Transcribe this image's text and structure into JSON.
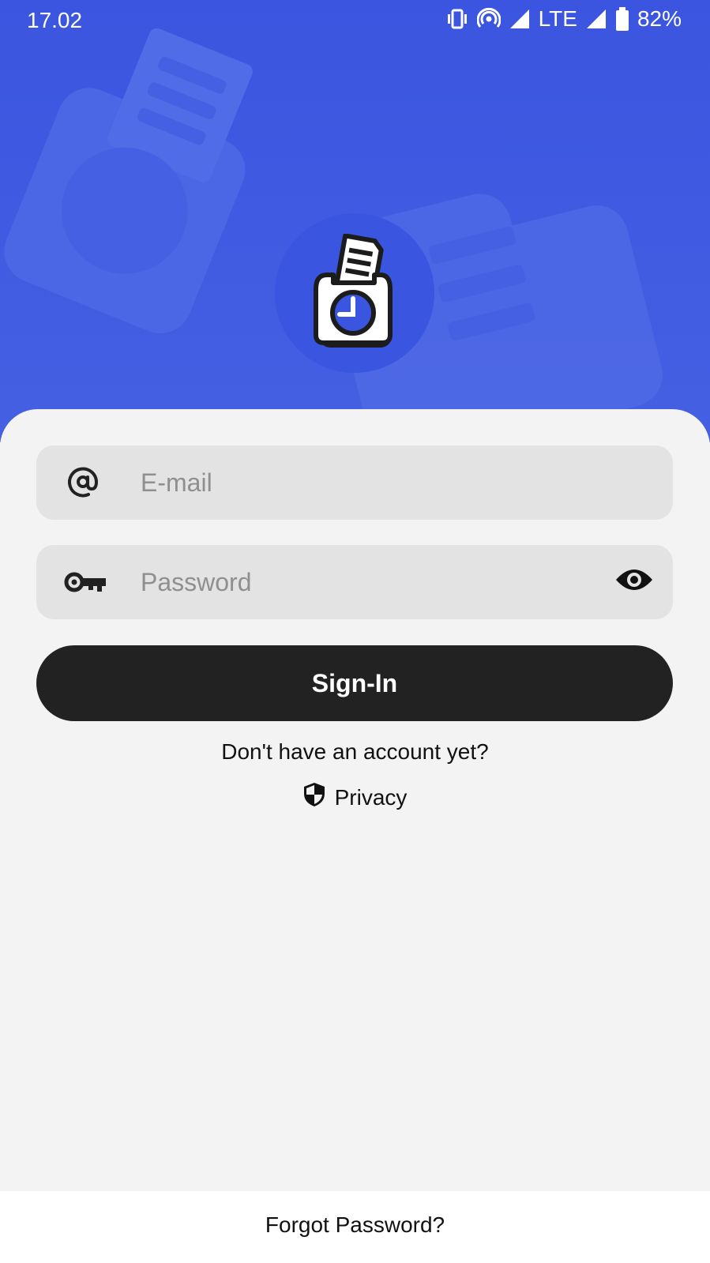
{
  "status_bar": {
    "time": "17.02",
    "network": "LTE",
    "battery": "82%",
    "icons": [
      "vibrate-icon",
      "hotspot-icon",
      "signal-icon",
      "signal-icon",
      "battery-icon"
    ]
  },
  "header": {
    "logo_icon": "lock-clock-document-icon",
    "background_color": "#3b55e0"
  },
  "login_form": {
    "email": {
      "placeholder": "E-mail",
      "value": "",
      "icon": "at-icon"
    },
    "password": {
      "placeholder": "Password",
      "value": "",
      "icon": "key-icon",
      "toggle_icon": "eye-icon"
    },
    "signin_label": "Sign-In",
    "signup_prompt": "Don't have an account yet?",
    "privacy_label": "Privacy",
    "privacy_icon": "shield-icon"
  },
  "footer": {
    "forgot_password": "Forgot Password?"
  },
  "colors": {
    "accent": "#3b55e0",
    "button": "#222222",
    "field_bg": "#e3e3e4",
    "card_bg": "#f3f3f4"
  }
}
